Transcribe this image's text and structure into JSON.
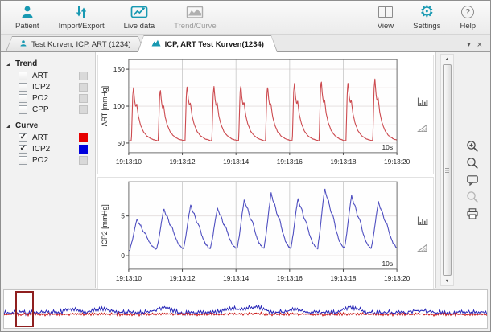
{
  "toolbar": {
    "items": [
      {
        "label": "Patient",
        "enabled": true
      },
      {
        "label": "Import/Export",
        "enabled": true
      },
      {
        "label": "Live data",
        "enabled": true
      },
      {
        "label": "Trend/Curve",
        "enabled": false
      },
      {
        "label": "View",
        "enabled": true
      },
      {
        "label": "Settings",
        "enabled": true
      },
      {
        "label": "Help",
        "enabled": true
      }
    ],
    "accent_color": "#1899b2"
  },
  "window_controls": {
    "overflow_glyph": "▾",
    "close_glyph": "×"
  },
  "tabs": [
    {
      "label": "Test Kurven, ICP, ART (1234)",
      "active": false
    },
    {
      "label": "ICP, ART Test Kurven(1234)",
      "active": true
    }
  ],
  "sidebar": {
    "sections": [
      {
        "label": "Trend",
        "items": [
          {
            "label": "ART",
            "checked": false,
            "swatch": "#d9d9d9"
          },
          {
            "label": "ICP2",
            "checked": false,
            "swatch": "#d9d9d9"
          },
          {
            "label": "PO2",
            "checked": false,
            "swatch": "#d9d9d9"
          },
          {
            "label": "CPP",
            "checked": false,
            "swatch": "#d9d9d9"
          }
        ]
      },
      {
        "label": "Curve",
        "items": [
          {
            "label": "ART",
            "checked": true,
            "swatch": "#e60000"
          },
          {
            "label": "ICP2",
            "checked": true,
            "swatch": "#0000dd"
          },
          {
            "label": "PO2",
            "checked": false,
            "swatch": "#d9d9d9"
          }
        ]
      }
    ]
  },
  "chart_data": [
    {
      "type": "line",
      "signal": "ART",
      "ylabel": "ART [mmHg]",
      "color": "#cc4a4f",
      "y_ticks": [
        50,
        100,
        150
      ],
      "ylim": [
        37,
        163
      ],
      "x_seconds": [
        0,
        10
      ],
      "x_tick_seconds": [
        0,
        2,
        4,
        6,
        8,
        10
      ],
      "x_tick_labels": [
        "19:13:10",
        "19:13:12",
        "19:13:14",
        "19:13:16",
        "19:13:18",
        "19:13:20"
      ],
      "window_length_label": "10s",
      "waveform": {
        "period_s": 1.0,
        "offset_s": 0.1,
        "baseline": 53,
        "noise": 0.35,
        "peaks": [
          125,
          123,
          128,
          127,
          129,
          127,
          131,
          135,
          133,
          137
        ],
        "shape": [
          [
            0,
            0
          ],
          [
            0.05,
            0.85
          ],
          [
            0.08,
            1
          ],
          [
            0.12,
            0.76
          ],
          [
            0.16,
            0.64
          ],
          [
            0.2,
            0.69
          ],
          [
            0.26,
            0.46
          ],
          [
            0.34,
            0.3
          ],
          [
            0.45,
            0.17
          ],
          [
            0.58,
            0.09
          ],
          [
            0.75,
            0.035
          ],
          [
            0.92,
            0.008
          ],
          [
            1,
            0
          ]
        ]
      }
    },
    {
      "type": "line",
      "signal": "ICP2",
      "ylabel": "ICP2 [mmHg]",
      "color": "#4e4ec0",
      "y_ticks": [
        0,
        5
      ],
      "ylim": [
        -1.7,
        9.3
      ],
      "x_seconds": [
        0,
        10
      ],
      "x_tick_seconds": [
        0,
        2,
        4,
        6,
        8,
        10
      ],
      "x_tick_labels": [
        "19:13:10",
        "19:13:12",
        "19:13:14",
        "19:13:16",
        "19:13:18",
        "19:13:20"
      ],
      "window_length_label": "10s",
      "waveform": {
        "period_s": 1.0,
        "offset_s": 0.05,
        "baseline": 0.7,
        "noise": 0.07,
        "peaks": [
          4.6,
          5.9,
          6.4,
          6.0,
          7.1,
          7.9,
          7.2,
          8.5,
          7.6,
          6.8
        ],
        "shape": [
          [
            0,
            0.05
          ],
          [
            0.08,
            0.3
          ],
          [
            0.18,
            0.72
          ],
          [
            0.26,
            1
          ],
          [
            0.33,
            0.86
          ],
          [
            0.4,
            0.8
          ],
          [
            0.48,
            0.62
          ],
          [
            0.58,
            0.54
          ],
          [
            0.68,
            0.32
          ],
          [
            0.8,
            0.15
          ],
          [
            0.92,
            0.06
          ],
          [
            1,
            0.03
          ]
        ]
      }
    }
  ],
  "chart_side_buttons": [
    "bar-chart",
    "slope"
  ],
  "right_rail_buttons": [
    "zoom-in",
    "zoom-out",
    "comment",
    "search",
    "print"
  ],
  "scrollbar": {
    "up_glyph": "▲",
    "down_glyph": "▼"
  },
  "overview": {
    "red_color": "#cc2020",
    "blue_color": "#2828b8",
    "selection": {
      "start_frac": 0.024,
      "end_frac": 0.062,
      "border_color": "#8f1f1f"
    },
    "blue_bumps": [
      [
        0.14,
        3
      ],
      [
        0.2,
        4
      ],
      [
        0.33,
        6
      ],
      [
        0.47,
        5
      ],
      [
        0.52,
        7
      ],
      [
        0.6,
        3
      ],
      [
        0.72,
        6
      ],
      [
        0.86,
        2.5
      ]
    ]
  }
}
